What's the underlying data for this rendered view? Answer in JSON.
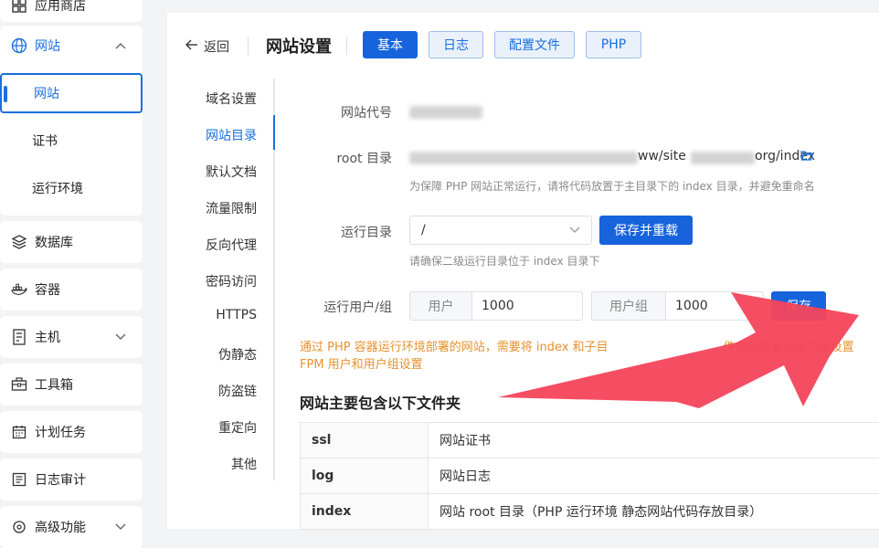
{
  "sidebar": {
    "items": [
      {
        "label": "应用商店",
        "icon": "grid-icon"
      },
      {
        "label": "网站",
        "icon": "globe-icon",
        "expanded": true
      },
      {
        "label": "数据库",
        "icon": "database-icon"
      },
      {
        "label": "容器",
        "icon": "docker-icon"
      },
      {
        "label": "主机",
        "icon": "host-icon"
      },
      {
        "label": "工具箱",
        "icon": "toolbox-icon"
      },
      {
        "label": "计划任务",
        "icon": "calendar-icon"
      },
      {
        "label": "日志审计",
        "icon": "log-icon"
      },
      {
        "label": "高级功能",
        "icon": "advanced-icon"
      }
    ],
    "website_sub": [
      "网站",
      "证书",
      "运行环境"
    ],
    "accent": "#1a6fe0"
  },
  "header": {
    "back_label": "返回",
    "title": "网站设置",
    "tabs": [
      "基本",
      "日志",
      "配置文件",
      "PHP"
    ],
    "active_tab": "基本"
  },
  "vtabs": [
    "域名设置",
    "网站目录",
    "默认文档",
    "流量限制",
    "反向代理",
    "密码访问",
    "HTTPS",
    "伪静态",
    "防盗链",
    "重定向",
    "其他"
  ],
  "active_vtab": "网站目录",
  "form": {
    "site_code_label": "网站代号",
    "root_label": "root 目录",
    "root_value_visible": "ww/site",
    "root_value_suffix": "org/index",
    "root_hint": "为保障 PHP 网站正常运行，请将代码放置于主目录下的 index 目录，并避免重命名",
    "run_dir_label": "运行目录",
    "run_dir_value": "/",
    "save_reload_label": "保存并重载",
    "run_dir_hint": "请确保二级运行目录位于 index 目录下",
    "run_user_label": "运行用户/组",
    "user_addon": "用户",
    "user_value": "1000",
    "group_addon": "用户组",
    "group_value": "1000",
    "save_label": "保存"
  },
  "warning": {
    "line1": "通过 PHP 容器运行环境部署的网站，需要将 index 和子目",
    "line1_tail": "件夹所有者和用户组设置",
    "line2": "FPM 用户和用户组设置",
    "color": "#e6922e"
  },
  "section_title": "网站主要包含以下文件夹",
  "files": [
    {
      "name": "ssl",
      "desc": "网站证书"
    },
    {
      "name": "log",
      "desc": "网站日志"
    },
    {
      "name": "index",
      "desc": "网站 root 目录（PHP 运行环境 静态网站代码存放目录）"
    }
  ],
  "annotation_arrow_color": "#f4455a"
}
